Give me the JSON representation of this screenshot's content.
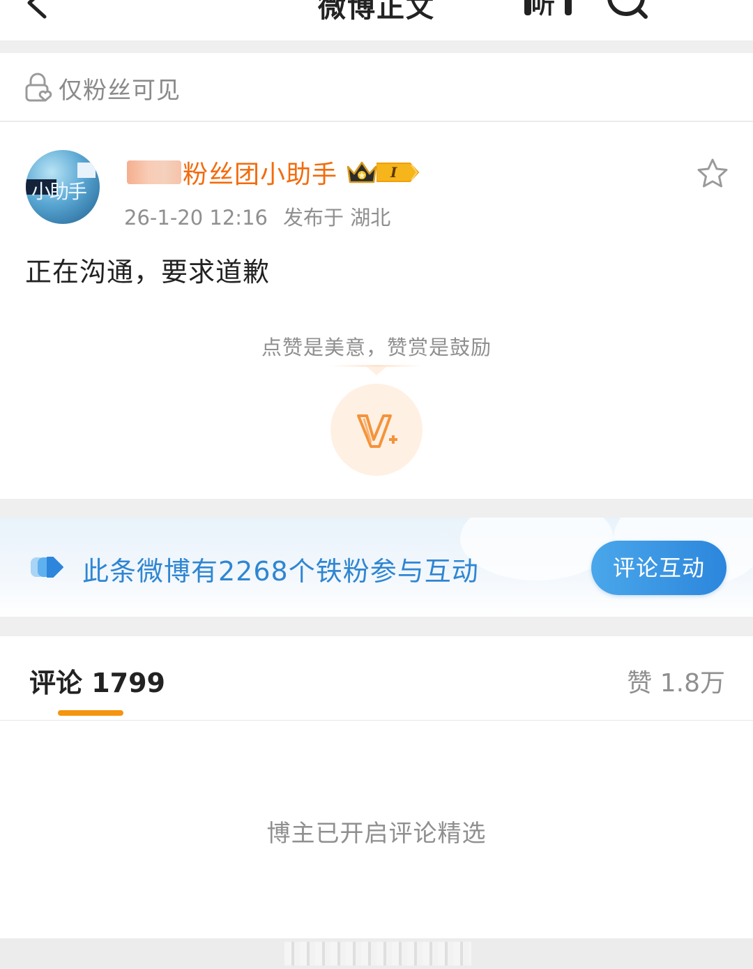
{
  "topbar": {
    "title": "微博正文",
    "listen_label": "听"
  },
  "visibility": {
    "label": "仅粉丝可见"
  },
  "post": {
    "author_name": "粉丝团小助手",
    "avatar_text": "小助手",
    "fan_badge_level": "I",
    "timestamp": "26-1-20 12:16",
    "location": "发布于 湖北",
    "text": "正在沟通，要求道歉"
  },
  "reward": {
    "hint": "点赞是美意，赞赏是鼓励"
  },
  "fans_banner": {
    "text": "此条微博有2268个铁粉参与互动",
    "button_label": "评论互动"
  },
  "comments": {
    "tab_label": "评论 1799",
    "likes_label": "赞 1.8万",
    "empty_note": "博主已开启评论精选"
  },
  "colors": {
    "author_orange": "#f26b0c",
    "link_blue": "#2f86d2",
    "tab_underline": "#f5940f",
    "reward_bg": "#fff0e4"
  },
  "icons": [
    "back-icon",
    "headphones-icon",
    "search-icon",
    "more-icon",
    "lock-heart-icon",
    "crown-icon",
    "star-icon",
    "reward-v-plus-icon",
    "fans-icon"
  ]
}
